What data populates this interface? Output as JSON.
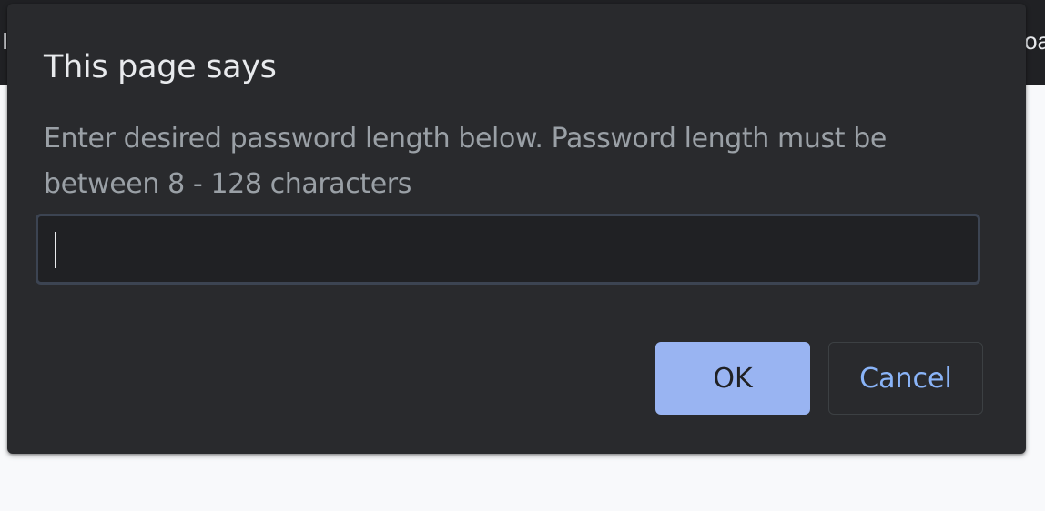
{
  "background_page": {
    "left_fragment": "I",
    "right_fragment": "oa"
  },
  "dialog": {
    "title": "This page says",
    "message": "Enter desired password length below. Password length must be between 8 - 128 characters",
    "input_value": "",
    "ok_label": "OK",
    "cancel_label": "Cancel"
  },
  "colors": {
    "dialog_background": "#292a2d",
    "ok_button": "#99b4f2",
    "cancel_text": "#8ab4f8",
    "message_text": "#9aa0a6"
  }
}
